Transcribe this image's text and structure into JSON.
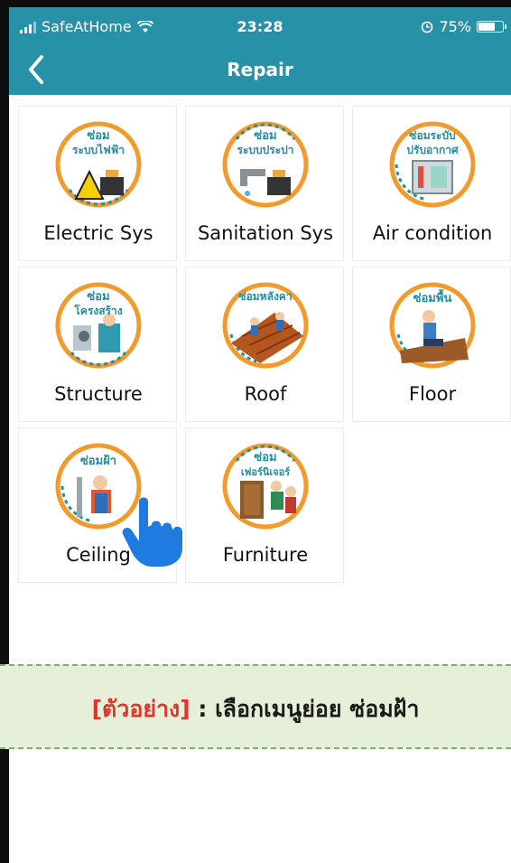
{
  "status_bar": {
    "carrier": "SafeAtHome",
    "time": "23:28",
    "battery": "75%",
    "battery_level": 0.75
  },
  "nav": {
    "title": "Repair"
  },
  "menu": [
    {
      "label": "Electric Sys",
      "badge": "ซ่อม\nระบบไฟฟ้า",
      "icon": "electric-repair-icon"
    },
    {
      "label": "Sanitation Sys",
      "badge": "ซ่อม\nระบบประปา",
      "icon": "plumbing-repair-icon"
    },
    {
      "label": "Air condition",
      "badge": "ซ่อมระบับ\nปรับอากาศ",
      "icon": "aircon-repair-icon"
    },
    {
      "label": "Structure",
      "badge": "ซ่อม\nโครงสร้าง",
      "icon": "structure-repair-icon"
    },
    {
      "label": "Roof",
      "badge": "ซ่อมหลังคา",
      "icon": "roof-repair-icon"
    },
    {
      "label": "Floor",
      "badge": "ซ่อมพื้น",
      "icon": "floor-repair-icon"
    },
    {
      "label": "Ceiling",
      "badge": "ซ่อมฝ้า",
      "icon": "ceiling-repair-icon"
    },
    {
      "label": "Furniture",
      "badge": "ซ่อม\nเฟอร์นิเจอร์",
      "icon": "furniture-repair-icon"
    }
  ],
  "banner": {
    "prefix": "[ตัวอย่าง]",
    "text": " : เลือกเมนูย่อย ซ่อมฝ้า"
  },
  "colors": {
    "header": "#2791a7",
    "badge_text": "#1f8fa0",
    "ring": "#f39a2c",
    "banner_bg": "#e6f0d8",
    "banner_accent": "#e0342f"
  }
}
